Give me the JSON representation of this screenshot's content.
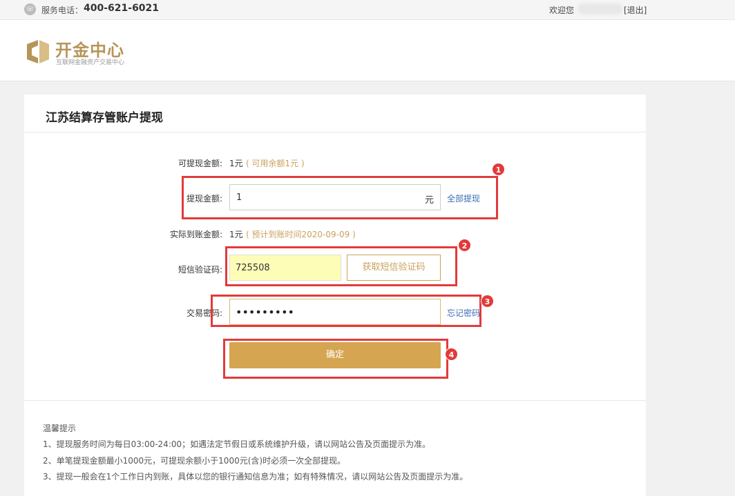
{
  "topbar": {
    "service_label": "服务电话：",
    "service_phone": "400-621-6021",
    "welcome": "欢迎您",
    "logout": "[退出]"
  },
  "header": {
    "logo_title": "开金中心",
    "logo_subtitle": "互联网金融资产交易中心"
  },
  "card": {
    "title": "江苏结算存管账户提现"
  },
  "form": {
    "available_label": "可提现金额:",
    "available_value": "1元",
    "available_note": "( 可用余额1元 )",
    "amount_label": "提现金额:",
    "amount_value": "1",
    "amount_unit": "元",
    "withdraw_all": "全部提现",
    "actual_label": "实际到账金额:",
    "actual_value": "1元",
    "actual_note": "( 预计到账时间2020-09-09 )",
    "sms_label": "短信验证码:",
    "sms_value": "725508",
    "sms_button": "获取短信验证码",
    "pwd_label": "交易密码:",
    "pwd_value": "•••••••••",
    "forgot_pwd": "忘记密码",
    "confirm": "确定"
  },
  "annotations": [
    "1",
    "2",
    "3",
    "4"
  ],
  "tips": {
    "title": "温馨提示",
    "items": [
      "1、提现服务时间为每日03:00-24:00；如遇法定节假日或系统维护升级，请以网站公告及页面提示为准。",
      "2、单笔提现金额最小1000元，可提现余额小于1000元(含)时必须一次全部提现。",
      "3、提现一般会在1个工作日内到账，具体以您的银行通知信息为准；如有特殊情况，请以网站公告及页面提示为准。"
    ]
  },
  "colors": {
    "accent_gold": "#d6a552",
    "link_blue": "#3b6cb5",
    "annotation_red": "#e33a3a",
    "sms_input_bg": "#fdfdb8"
  }
}
